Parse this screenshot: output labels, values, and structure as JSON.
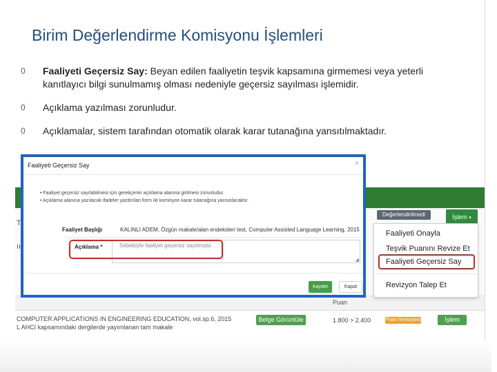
{
  "slide": {
    "title": "Birim Değerlendirme Komisyonu İşlemleri",
    "bullet_marker": "0",
    "bullets": [
      {
        "bold": "Faaliyeti Geçersiz Say:",
        "line1": " Beyan edilen faaliyetin teşvik kapsamına girmemesi veya yeterli",
        "line2": "kanıtlayıcı bilgi sunulmamış olması nedeniyle geçersiz sayılması işlemidir."
      },
      {
        "text": "Açıklama yazılması zorunludur."
      },
      {
        "text": "Açıklamalar, sistem tarafından otomatik olarak karar tutanağına yansıtılmaktadır."
      }
    ]
  },
  "background_page": {
    "letters": [
      "Tü",
      "ıı"
    ],
    "status_badge": "Değerlendirilmedi",
    "islem_label": "İşlem",
    "puan_label": "Puan",
    "row_line1": "COMPUTER APPLICATIONS IN ENGINEERING EDUCATION, vol.sp.6, 2015",
    "row_line2": "L AHCI kapsamındaki dergilerde yayımlanan tam makale",
    "belge_button": "Belge Görüntüle",
    "score_text": "1.800 > 2.400",
    "puan_badge": "Puan Revizyonu",
    "row_islem": "İşlem"
  },
  "dropdown": {
    "items": [
      "Faaliyeti Onayla",
      "Teşvik Puanını Revize Et",
      "Faaliyeti Geçersiz Say",
      "Revizyon Talep Et"
    ]
  },
  "modal": {
    "title": "Faaliyeti Geçersiz Say",
    "close_glyph": "×",
    "info_lines": [
      "• Faaliyet geçersiz sayılabilmesi için gerekçenin açıklama alanına girilmesi zorunludur.",
      "• Açıklama alanına yazılacak ifadeler yazdırılan form ile komisyon karar tutanağına yansıtılacaktır."
    ],
    "faaliyet_label": "Faaliyet Başlığı",
    "faaliyet_value": "KALINLI ADEM, Özgün makale/alan endeksleri test, Computer Assisted Language Learning, 2015",
    "aciklama_label": "Açıklama *",
    "aciklama_placeholder": "Sebebiyle faaliyet geçersiz sayılmıştır",
    "resize_glyph": "◢",
    "save_label": "Kaydet",
    "close_label": "Kapat"
  },
  "colors": {
    "title_blue": "#1f4e8c",
    "modal_border": "#1e63c8",
    "highlight_red": "#e32020",
    "green": "#43a047"
  }
}
